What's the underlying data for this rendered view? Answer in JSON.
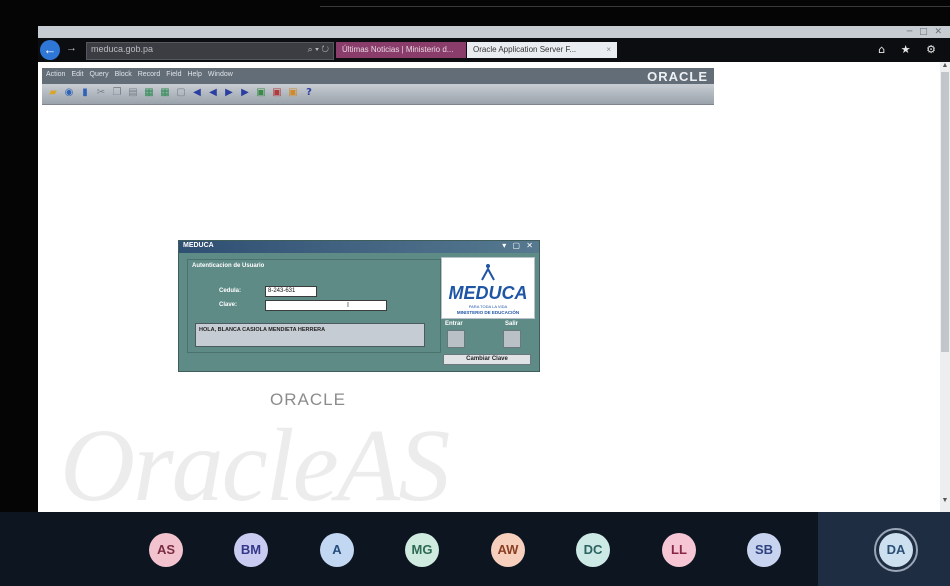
{
  "browser": {
    "address_host": "meduca.gob.pa",
    "tabs": [
      {
        "label": "Últimas Noticias | Ministerio d..."
      },
      {
        "label": "Oracle Application Server F...",
        "close": "×"
      }
    ]
  },
  "oracle_menu": {
    "items": [
      "Action",
      "Edit",
      "Query",
      "Block",
      "Record",
      "Field",
      "Help",
      "Window"
    ],
    "brand": "ORACLE"
  },
  "dialog": {
    "title": "MEDUCA",
    "group_label": "Autenticacion de Usuario",
    "cedula_label": "Cedula:",
    "cedula_value": "8-243-631",
    "clave_label": "Clave:",
    "clave_value": "",
    "message": "HOLA, BLANCA CASIOLA MENDIETA HERRERA",
    "logo": {
      "name": "MEDUCA",
      "tagline": "PARA TODA LA VIDA",
      "ministry": "MINISTERIO DE EDUCACIÓN"
    },
    "entrar_label": "Entrar",
    "salir_label": "Salir",
    "cambiar_label": "Cambiar Clave"
  },
  "page": {
    "oracle_logo": "ORACLE",
    "watermark": "OracleAS"
  },
  "participants": [
    {
      "initials": "AS",
      "color": "#f2c3cf",
      "text_color": "#7a2c40"
    },
    {
      "initials": "BM",
      "color": "#c9cbf0",
      "text_color": "#34388a"
    },
    {
      "initials": "A",
      "color": "#c2d8f2",
      "text_color": "#244c7c"
    },
    {
      "initials": "MG",
      "color": "#cfeadf",
      "text_color": "#2d6a52"
    },
    {
      "initials": "AW",
      "color": "#f6cfbd",
      "text_color": "#8a3f22"
    },
    {
      "initials": "DC",
      "color": "#cde9e6",
      "text_color": "#2a6360"
    },
    {
      "initials": "LL",
      "color": "#f6c6d4",
      "text_color": "#8a2748"
    },
    {
      "initials": "SB",
      "color": "#c8d3ef",
      "text_color": "#2f4380"
    },
    {
      "initials": "DA",
      "color": "#cde0ef",
      "text_color": "#2a4f75",
      "active": true
    }
  ]
}
